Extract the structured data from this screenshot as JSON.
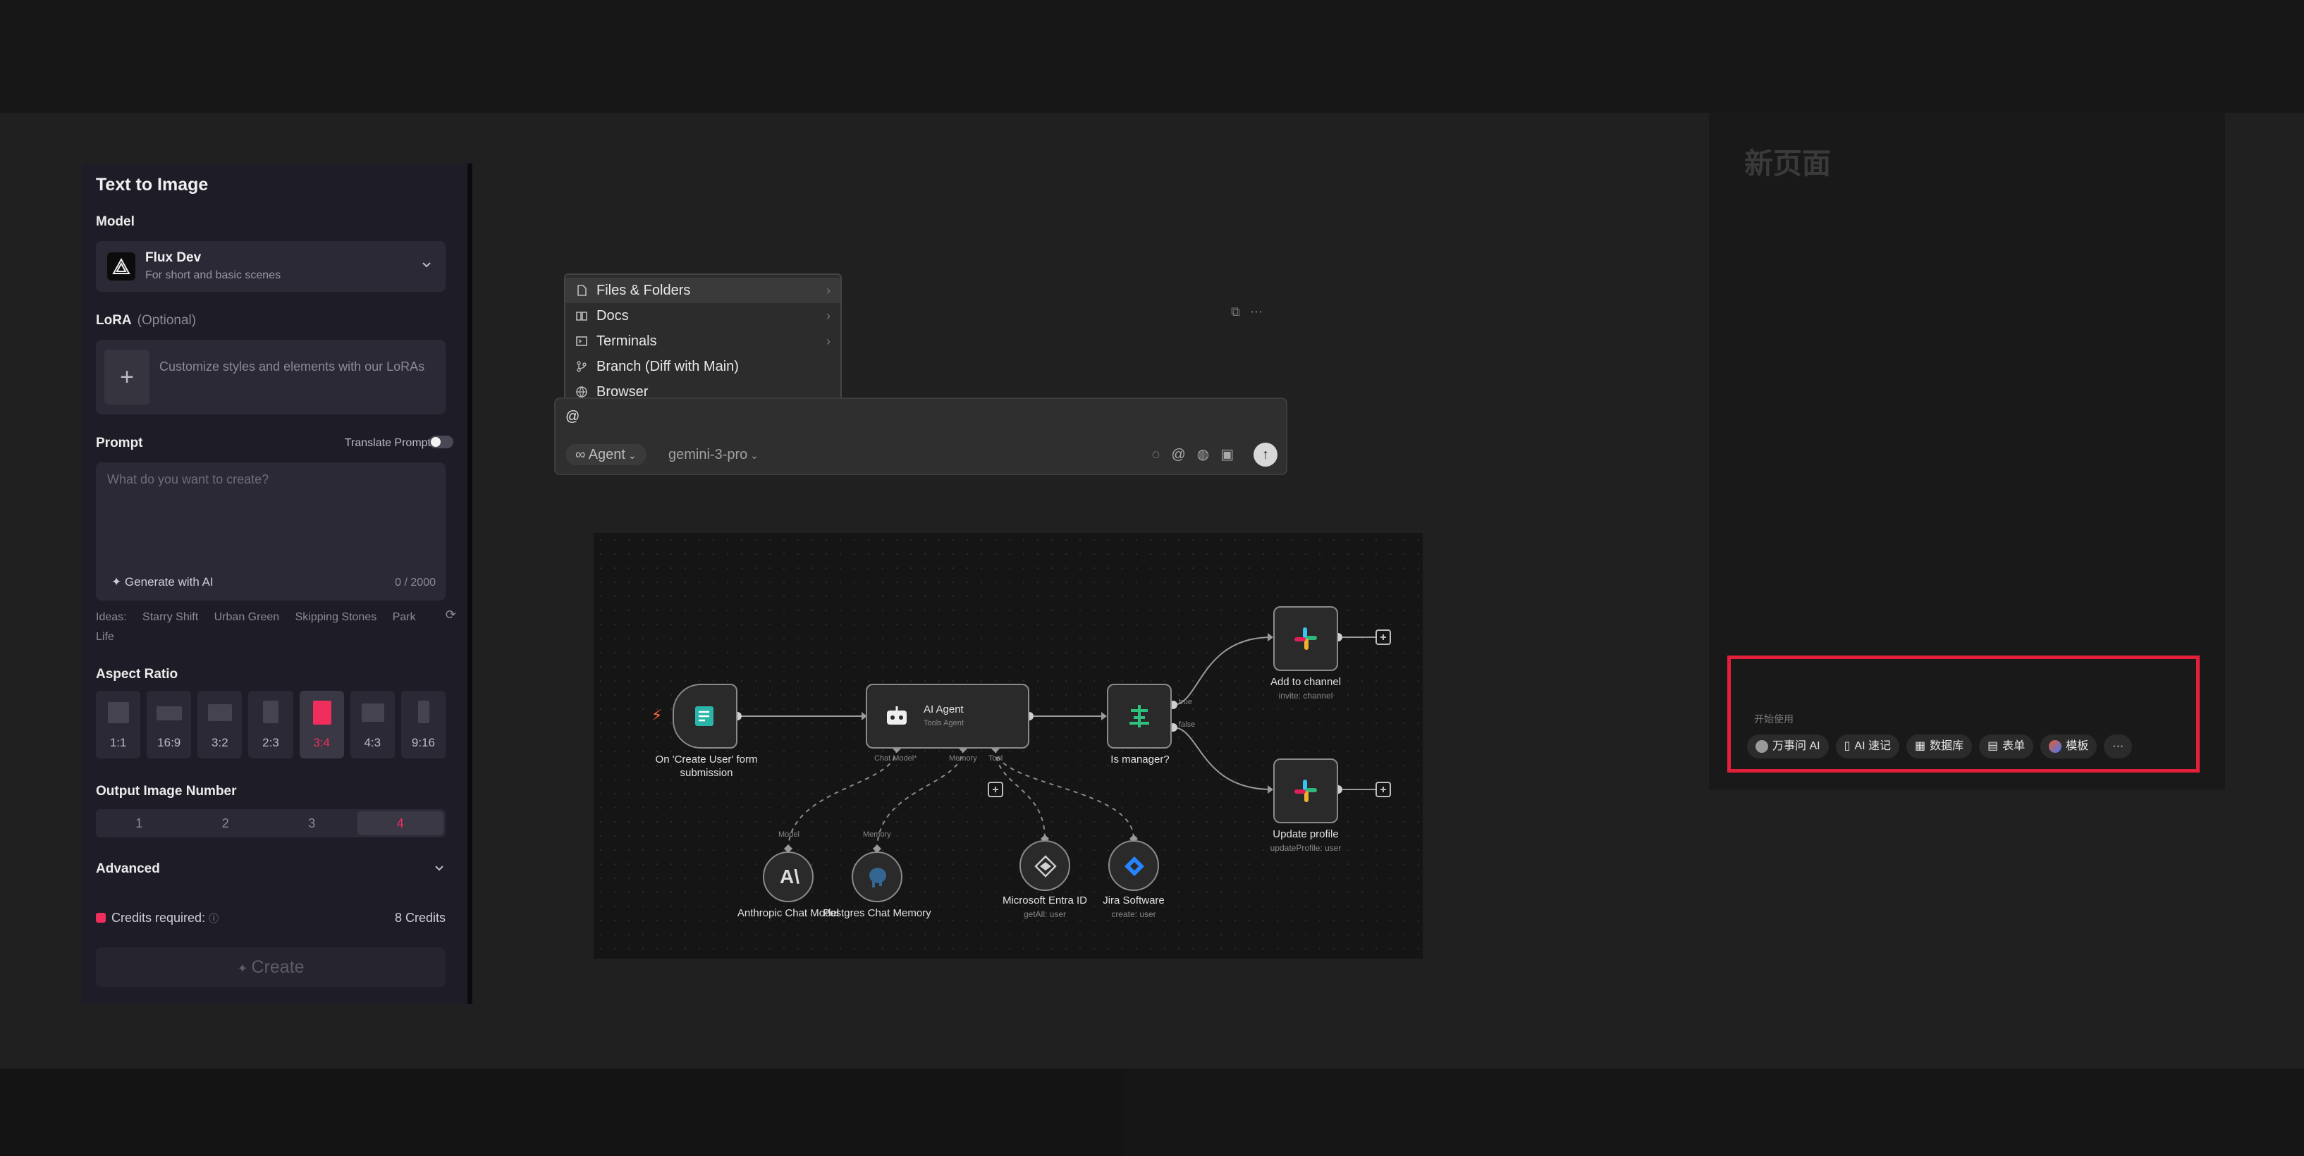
{
  "text_to_image": {
    "title": "Text to Image",
    "model_label": "Model",
    "model_name": "Flux Dev",
    "model_desc": "For short and basic scenes",
    "lora_label": "LoRA",
    "lora_optional": "(Optional)",
    "lora_placeholder": "Customize styles and elements with our LoRAs",
    "prompt_label": "Prompt",
    "translate_label": "Translate Prompt",
    "prompt_placeholder": "What do you want to create?",
    "generate_label": "Generate with AI",
    "counter": "0 / 2000",
    "ideas_label": "Ideas:",
    "ideas": [
      "Starry Shift",
      "Urban Green",
      "Skipping Stones",
      "Park Life"
    ],
    "aspect_label": "Aspect Ratio",
    "ratios": [
      "1:1",
      "16:9",
      "3:2",
      "2:3",
      "3:4",
      "4:3",
      "9:16"
    ],
    "active_ratio": "3:4",
    "output_label": "Output Image Number",
    "outputs": [
      "1",
      "2",
      "3",
      "4"
    ],
    "active_output": "4",
    "advanced_label": "Advanced",
    "credits_label": "Credits required:",
    "credits_value": "8 Credits",
    "create_label": "Create",
    "accent": "#f02e5d"
  },
  "mention_menu": {
    "items": [
      "Files & Folders",
      "Docs",
      "Terminals",
      "Branch (Diff with Main)",
      "Browser"
    ]
  },
  "composer": {
    "input_value": "@",
    "agent_label": "Agent",
    "model_label": "gemini-3-pro"
  },
  "workflow": {
    "trigger_label": "On 'Create User' form submission",
    "agent_title": "AI Agent",
    "agent_sub": "Tools Agent",
    "port_chat_model": "Chat Model*",
    "port_memory": "Memory",
    "port_tool": "Tool",
    "is_manager": "Is manager?",
    "branch_true": "true",
    "branch_false": "false",
    "add_channel": "Add to channel",
    "add_channel_sub": "invite: channel",
    "update_profile": "Update profile",
    "update_profile_sub": "updateProfile: user",
    "model_port": "Model",
    "memory_port": "Memory",
    "anthropic": "Anthropic Chat Model",
    "postgres": "Postgres Chat Memory",
    "entra": "Microsoft Entra ID",
    "entra_sub": "getAll: user",
    "jira": "Jira Software",
    "jira_sub": "create: user"
  },
  "right_page": {
    "title": "新页面",
    "start_label": "开始使用",
    "chips": [
      "万事问 AI",
      "AI 速记",
      "数据库",
      "表单",
      "模板"
    ],
    "more": "···"
  }
}
